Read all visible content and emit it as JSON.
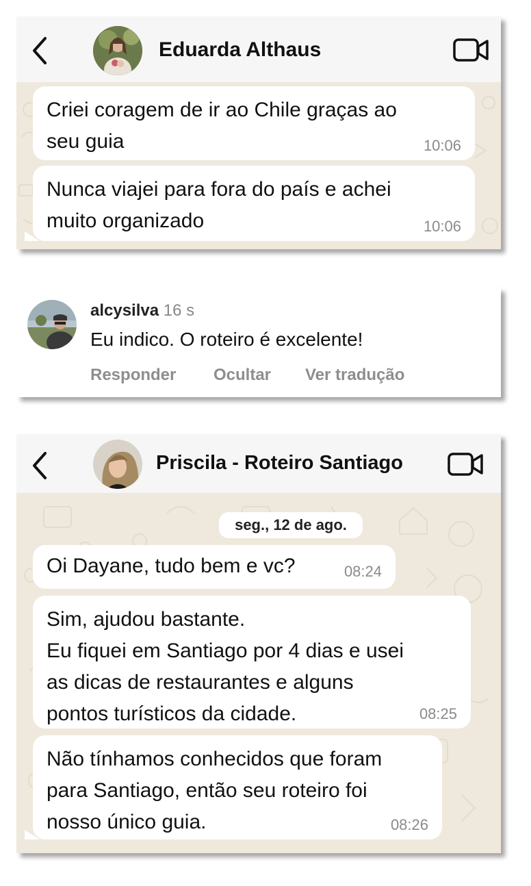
{
  "chat1": {
    "contact_name": "Eduarda Althaus",
    "messages": [
      {
        "text": "Criei coragem de ir ao Chile graças ao\nseu guia",
        "time": "10:06"
      },
      {
        "text": "Nunca viajei para fora do país e achei\nmuito organizado",
        "time": "10:06"
      }
    ]
  },
  "comment": {
    "username": "alcysilva",
    "age": "16 s",
    "text": "Eu indico. O roteiro é excelente!",
    "actions": [
      "Responder",
      "Ocultar",
      "Ver tradução"
    ]
  },
  "chat2": {
    "contact_name": "Priscila - Roteiro Santiago",
    "date": "seg., 12 de ago.",
    "messages": [
      {
        "text": "Oi Dayane, tudo bem e vc?",
        "time": "08:24"
      },
      {
        "text": "Sim, ajudou bastante.\nEu fiquei em Santiago por 4 dias e usei\nas dicas de restaurantes e alguns\npontos turísticos da cidade.",
        "time": "08:25"
      },
      {
        "text": "Não tínhamos conhecidos que foram\npara Santiago, então seu roteiro foi\nnosso único guia.",
        "time": "08:26"
      }
    ]
  },
  "colors": {
    "chat_background": "#efe8dd",
    "bubble": "#ffffff",
    "header": "#f6f6f6",
    "time_text": "#8a8a8a",
    "action_text": "#8e8e8e"
  },
  "icons": [
    "back-arrow-icon",
    "video-call-icon"
  ]
}
